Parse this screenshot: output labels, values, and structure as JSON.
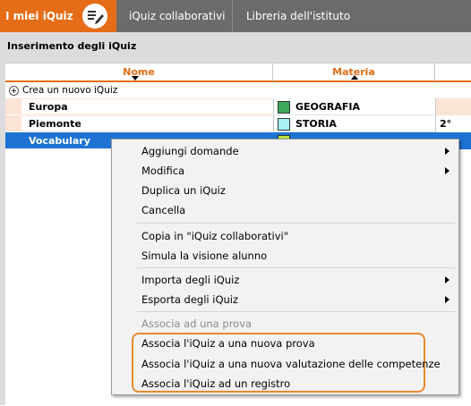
{
  "tabs": [
    {
      "label": "I miei iQuiz",
      "active": true
    },
    {
      "label": "iQuiz collaborativi",
      "active": false
    },
    {
      "label": "Libreria dell'istituto",
      "active": false
    }
  ],
  "section_title": "Inserimento degli iQuiz",
  "columns": {
    "nome": "Nome",
    "materia": "Materia"
  },
  "create_label": "Crea un nuovo iQuiz",
  "rows": [
    {
      "name": "Europa",
      "subject": "GEOGRAFIA",
      "subject_color": "#3daa5a",
      "extra": ""
    },
    {
      "name": "Piemonte",
      "subject": "STORIA",
      "subject_color": "#a8f0f4",
      "extra": "2°"
    },
    {
      "name": "Vocabulary",
      "subject": "",
      "subject_color": "#b9e33c",
      "extra": ""
    }
  ],
  "menu": {
    "items": [
      {
        "label": "Aggiungi domande",
        "submenu": true
      },
      {
        "label": "Modifica",
        "submenu": true
      },
      {
        "label": "Duplica un iQuiz",
        "submenu": false
      },
      {
        "label": "Cancella",
        "submenu": false
      },
      {
        "label": "Copia in \"iQuiz collaborativi\"",
        "submenu": false
      },
      {
        "label": "Simula la visione alunno",
        "submenu": false
      },
      {
        "label": "Importa degli iQuiz",
        "submenu": true
      },
      {
        "label": "Esporta degli iQuiz",
        "submenu": true
      },
      {
        "label": "Associa ad una prova",
        "submenu": false,
        "disabled": true
      },
      {
        "label": "Associa l'iQuiz a una nuova prova",
        "submenu": false
      },
      {
        "label": "Associa l'iQuiz a una nuova valutazione delle competenze",
        "submenu": false
      },
      {
        "label": "Associa l'iQuiz ad un registro",
        "submenu": false
      }
    ]
  },
  "colors": {
    "accent": "#e56d17",
    "selection": "#1e73d2",
    "highlight_border": "#e8892d"
  }
}
